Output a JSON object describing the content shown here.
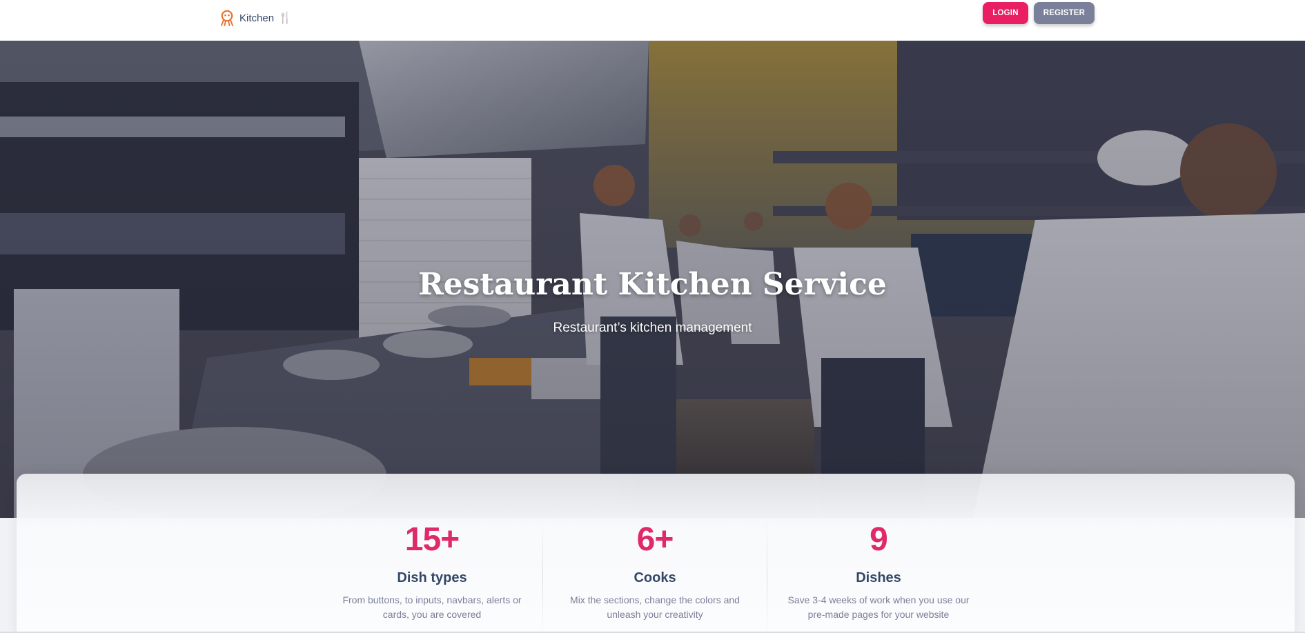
{
  "navbar": {
    "brand_text": "Kitchen",
    "brand_glyph": "🍴",
    "brand_icon": "chef-logo-icon",
    "login_label": "LOGIN",
    "register_label": "REGISTER"
  },
  "hero": {
    "title": "Restaurant Kitchen Service",
    "subtitle": "Restaurant’s kitchen management"
  },
  "stats": [
    {
      "value": "15+",
      "title": "Dish types",
      "desc": "From buttons, to inputs, navbars, alerts or cards, you are covered"
    },
    {
      "value": "6+",
      "title": "Cooks",
      "desc": "Mix the sections, change the colors and unleash your creativity"
    },
    {
      "value": "9",
      "title": "Dishes",
      "desc": "Save 3-4 weeks of work when you use our pre-made pages for your website"
    }
  ],
  "colors": {
    "primary": "#e91e63",
    "secondary": "#7b809a",
    "stat_number": "#e02968",
    "heading": "#344767",
    "muted": "#7b809a"
  }
}
